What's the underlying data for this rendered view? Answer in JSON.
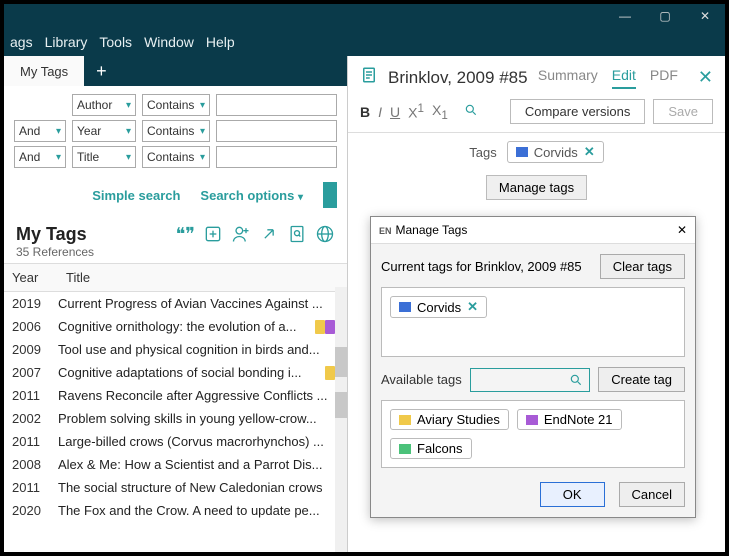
{
  "menubar": {
    "items": [
      "ags",
      "Library",
      "Tools",
      "Window",
      "Help"
    ]
  },
  "tabs": {
    "main": "My Tags"
  },
  "search": {
    "rows": [
      {
        "op": "",
        "field": "Author",
        "cond": "Contains"
      },
      {
        "op": "And",
        "field": "Year",
        "cond": "Contains"
      },
      {
        "op": "And",
        "field": "Title",
        "cond": "Contains"
      }
    ],
    "simple": "Simple search",
    "options": "Search options"
  },
  "group": {
    "name": "My Tags",
    "count": "35 References"
  },
  "table": {
    "headers": {
      "year": "Year",
      "title": "Title"
    },
    "rows": [
      {
        "year": "2019",
        "title": "Current Progress of Avian Vaccines Against ...",
        "tags": [
          "yellow"
        ]
      },
      {
        "year": "2006",
        "title": "Cognitive ornithology: the evolution of a...",
        "tags": [
          "yellow",
          "purple",
          "green"
        ]
      },
      {
        "year": "2009",
        "title": "Tool use and physical cognition in birds and...",
        "tags": [
          "yellow"
        ]
      },
      {
        "year": "2007",
        "title": "Cognitive adaptations of social bonding i...",
        "tags": [
          "yellow",
          "purple"
        ]
      },
      {
        "year": "2011",
        "title": "Ravens Reconcile after Aggressive Conflicts ...",
        "tags": [
          "yellow"
        ]
      },
      {
        "year": "2002",
        "title": "Problem solving skills in young yellow-crow...",
        "tags": [
          "purple"
        ]
      },
      {
        "year": "2011",
        "title": "Large-billed crows (Corvus macrorhynchos) ...",
        "tags": [
          "blue"
        ]
      },
      {
        "year": "2008",
        "title": "Alex & Me: How a Scientist and a Parrot Dis...",
        "tags": [
          "purple"
        ]
      },
      {
        "year": "2011",
        "title": "The social structure of New Caledonian crows",
        "tags": [
          "blue"
        ]
      },
      {
        "year": "2020",
        "title": "The Fox and the Crow. A need to update pe...",
        "tags": [
          "yellow"
        ]
      }
    ]
  },
  "doc": {
    "title": "Brinklov, 2009 #85",
    "tabs": {
      "summary": "Summary",
      "edit": "Edit",
      "pdf": "PDF"
    },
    "toolbar": {
      "compare": "Compare versions",
      "save": "Save"
    },
    "tags_label": "Tags",
    "current_tag": "Corvids",
    "manage": "Manage tags"
  },
  "dialog": {
    "title": "Manage Tags",
    "subtitle": "Current tags for Brinklov, 2009 #85",
    "clear": "Clear tags",
    "current": [
      {
        "color": "blue",
        "label": "Corvids"
      }
    ],
    "available_label": "Available tags",
    "create": "Create tag",
    "available": [
      {
        "color": "yellow",
        "label": "Aviary Studies"
      },
      {
        "color": "purple",
        "label": "EndNote 21"
      },
      {
        "color": "green",
        "label": "Falcons"
      }
    ],
    "ok": "OK",
    "cancel": "Cancel"
  }
}
